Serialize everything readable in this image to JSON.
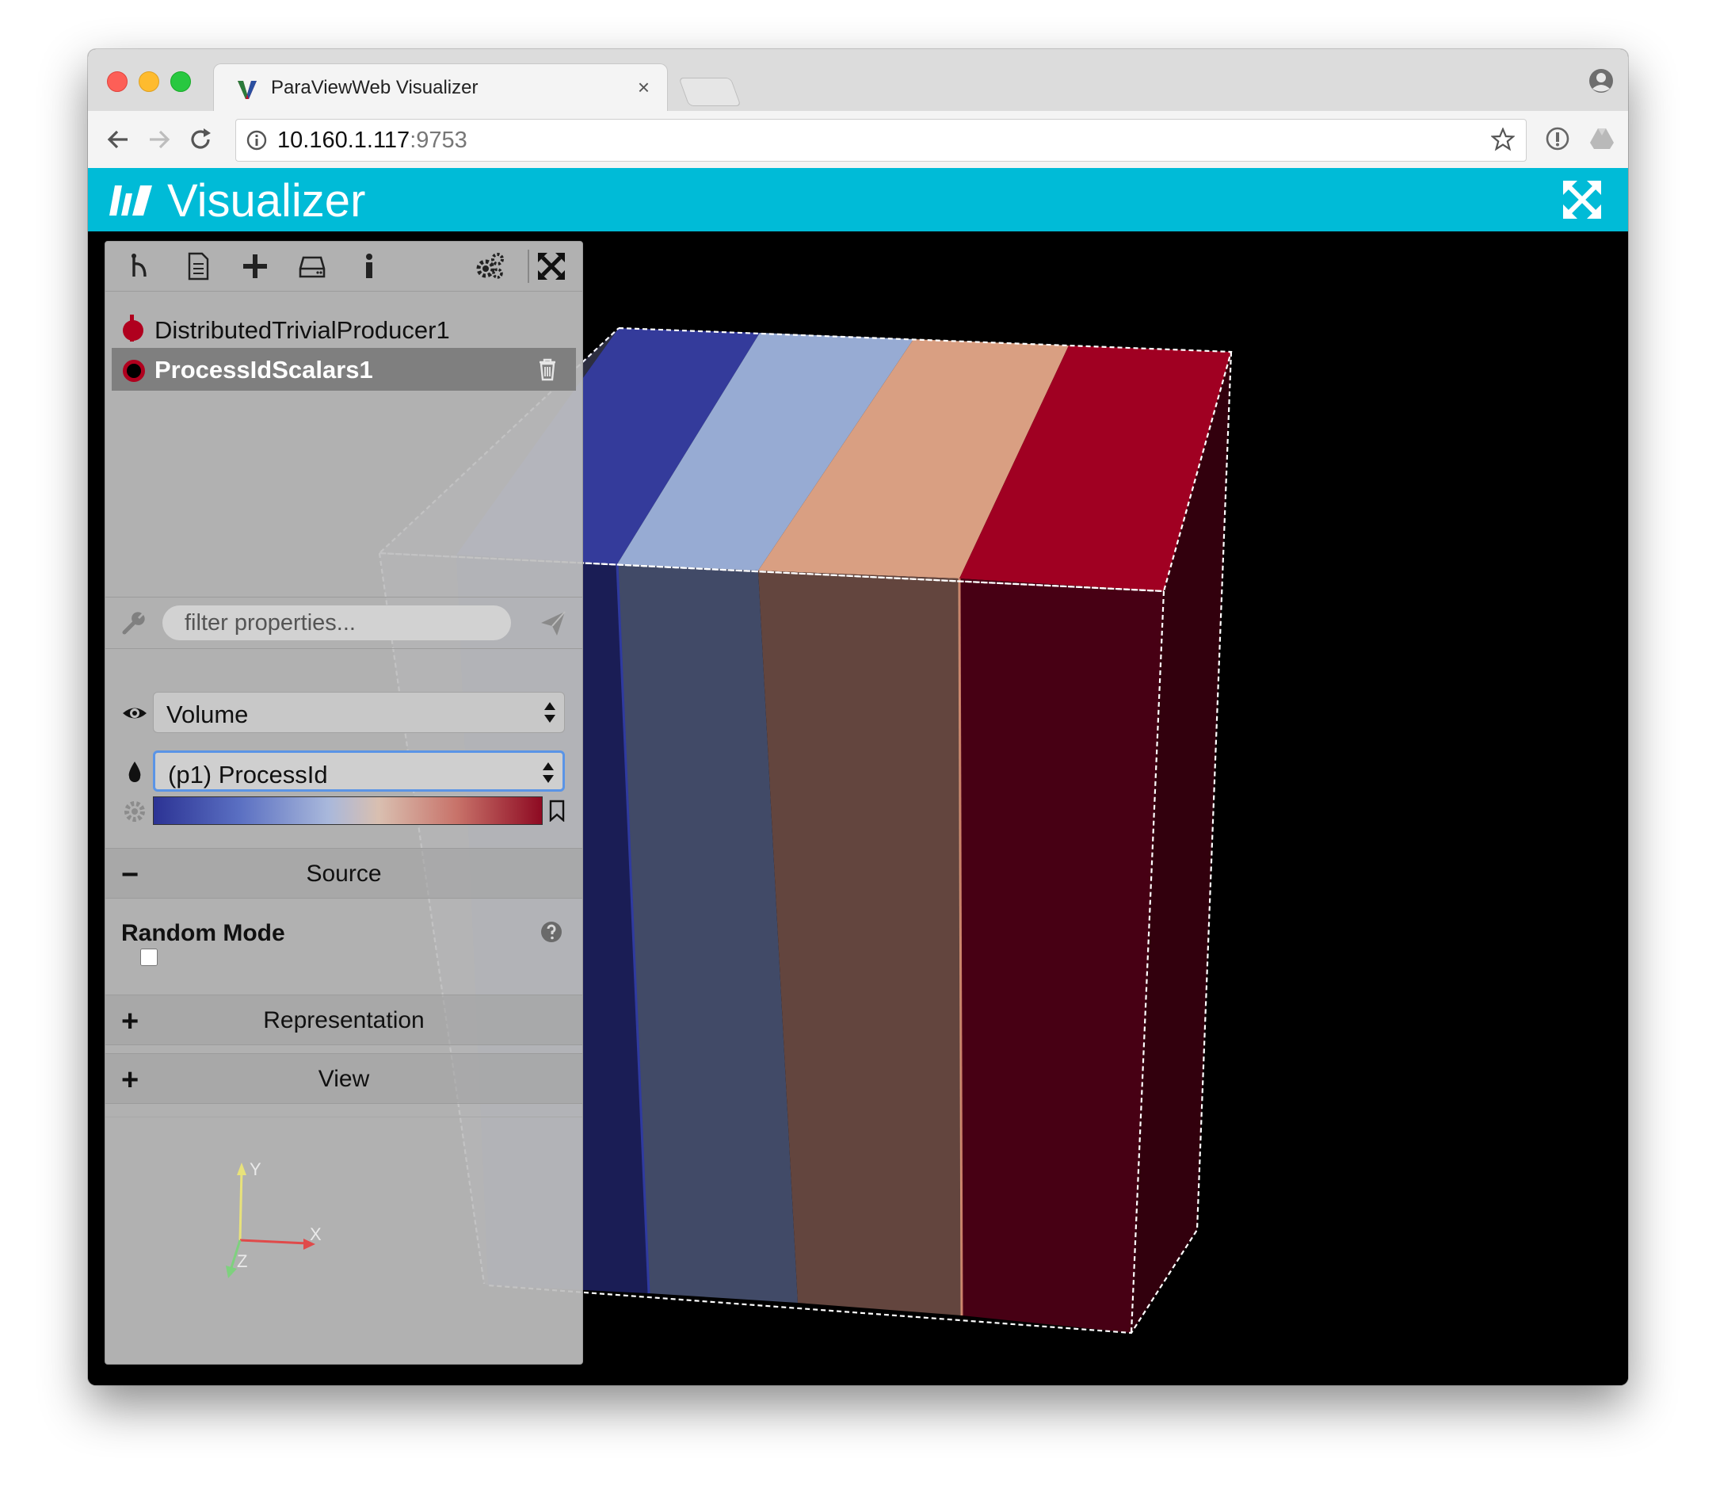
{
  "browser": {
    "tab_title": "ParaViewWeb Visualizer",
    "tab_close": "×",
    "url_host": "10.160.1.117",
    "url_port": ":9753"
  },
  "app": {
    "title": "Visualizer"
  },
  "pipeline": {
    "items": [
      {
        "label": "DistributedTrivialProducer1",
        "selected": false
      },
      {
        "label": "ProcessIdScalars1",
        "selected": true
      }
    ]
  },
  "filter": {
    "placeholder": "filter properties..."
  },
  "display": {
    "representation": "Volume",
    "color_by": "(p1) ProcessId"
  },
  "colormap": {
    "preset_colors": [
      "#2c3394",
      "#a9b8db",
      "#d9bfb0",
      "#8e0a22"
    ]
  },
  "sections": {
    "source_toggle": "−",
    "source": "Source",
    "representation_toggle": "+",
    "representation": "Representation",
    "view_toggle": "+",
    "view": "View"
  },
  "properties": {
    "random_mode_label": "Random Mode",
    "random_mode_checked": false
  },
  "axes": {
    "x": "X",
    "y": "Y",
    "z": "Z"
  },
  "colors": {
    "app_header": "#00bbd7",
    "pipeline_accent": "#b0001e",
    "slab_1": "#343b9b",
    "slab_2": "#97abd3",
    "slab_3": "#d99f82",
    "slab_4": "#a00022"
  }
}
